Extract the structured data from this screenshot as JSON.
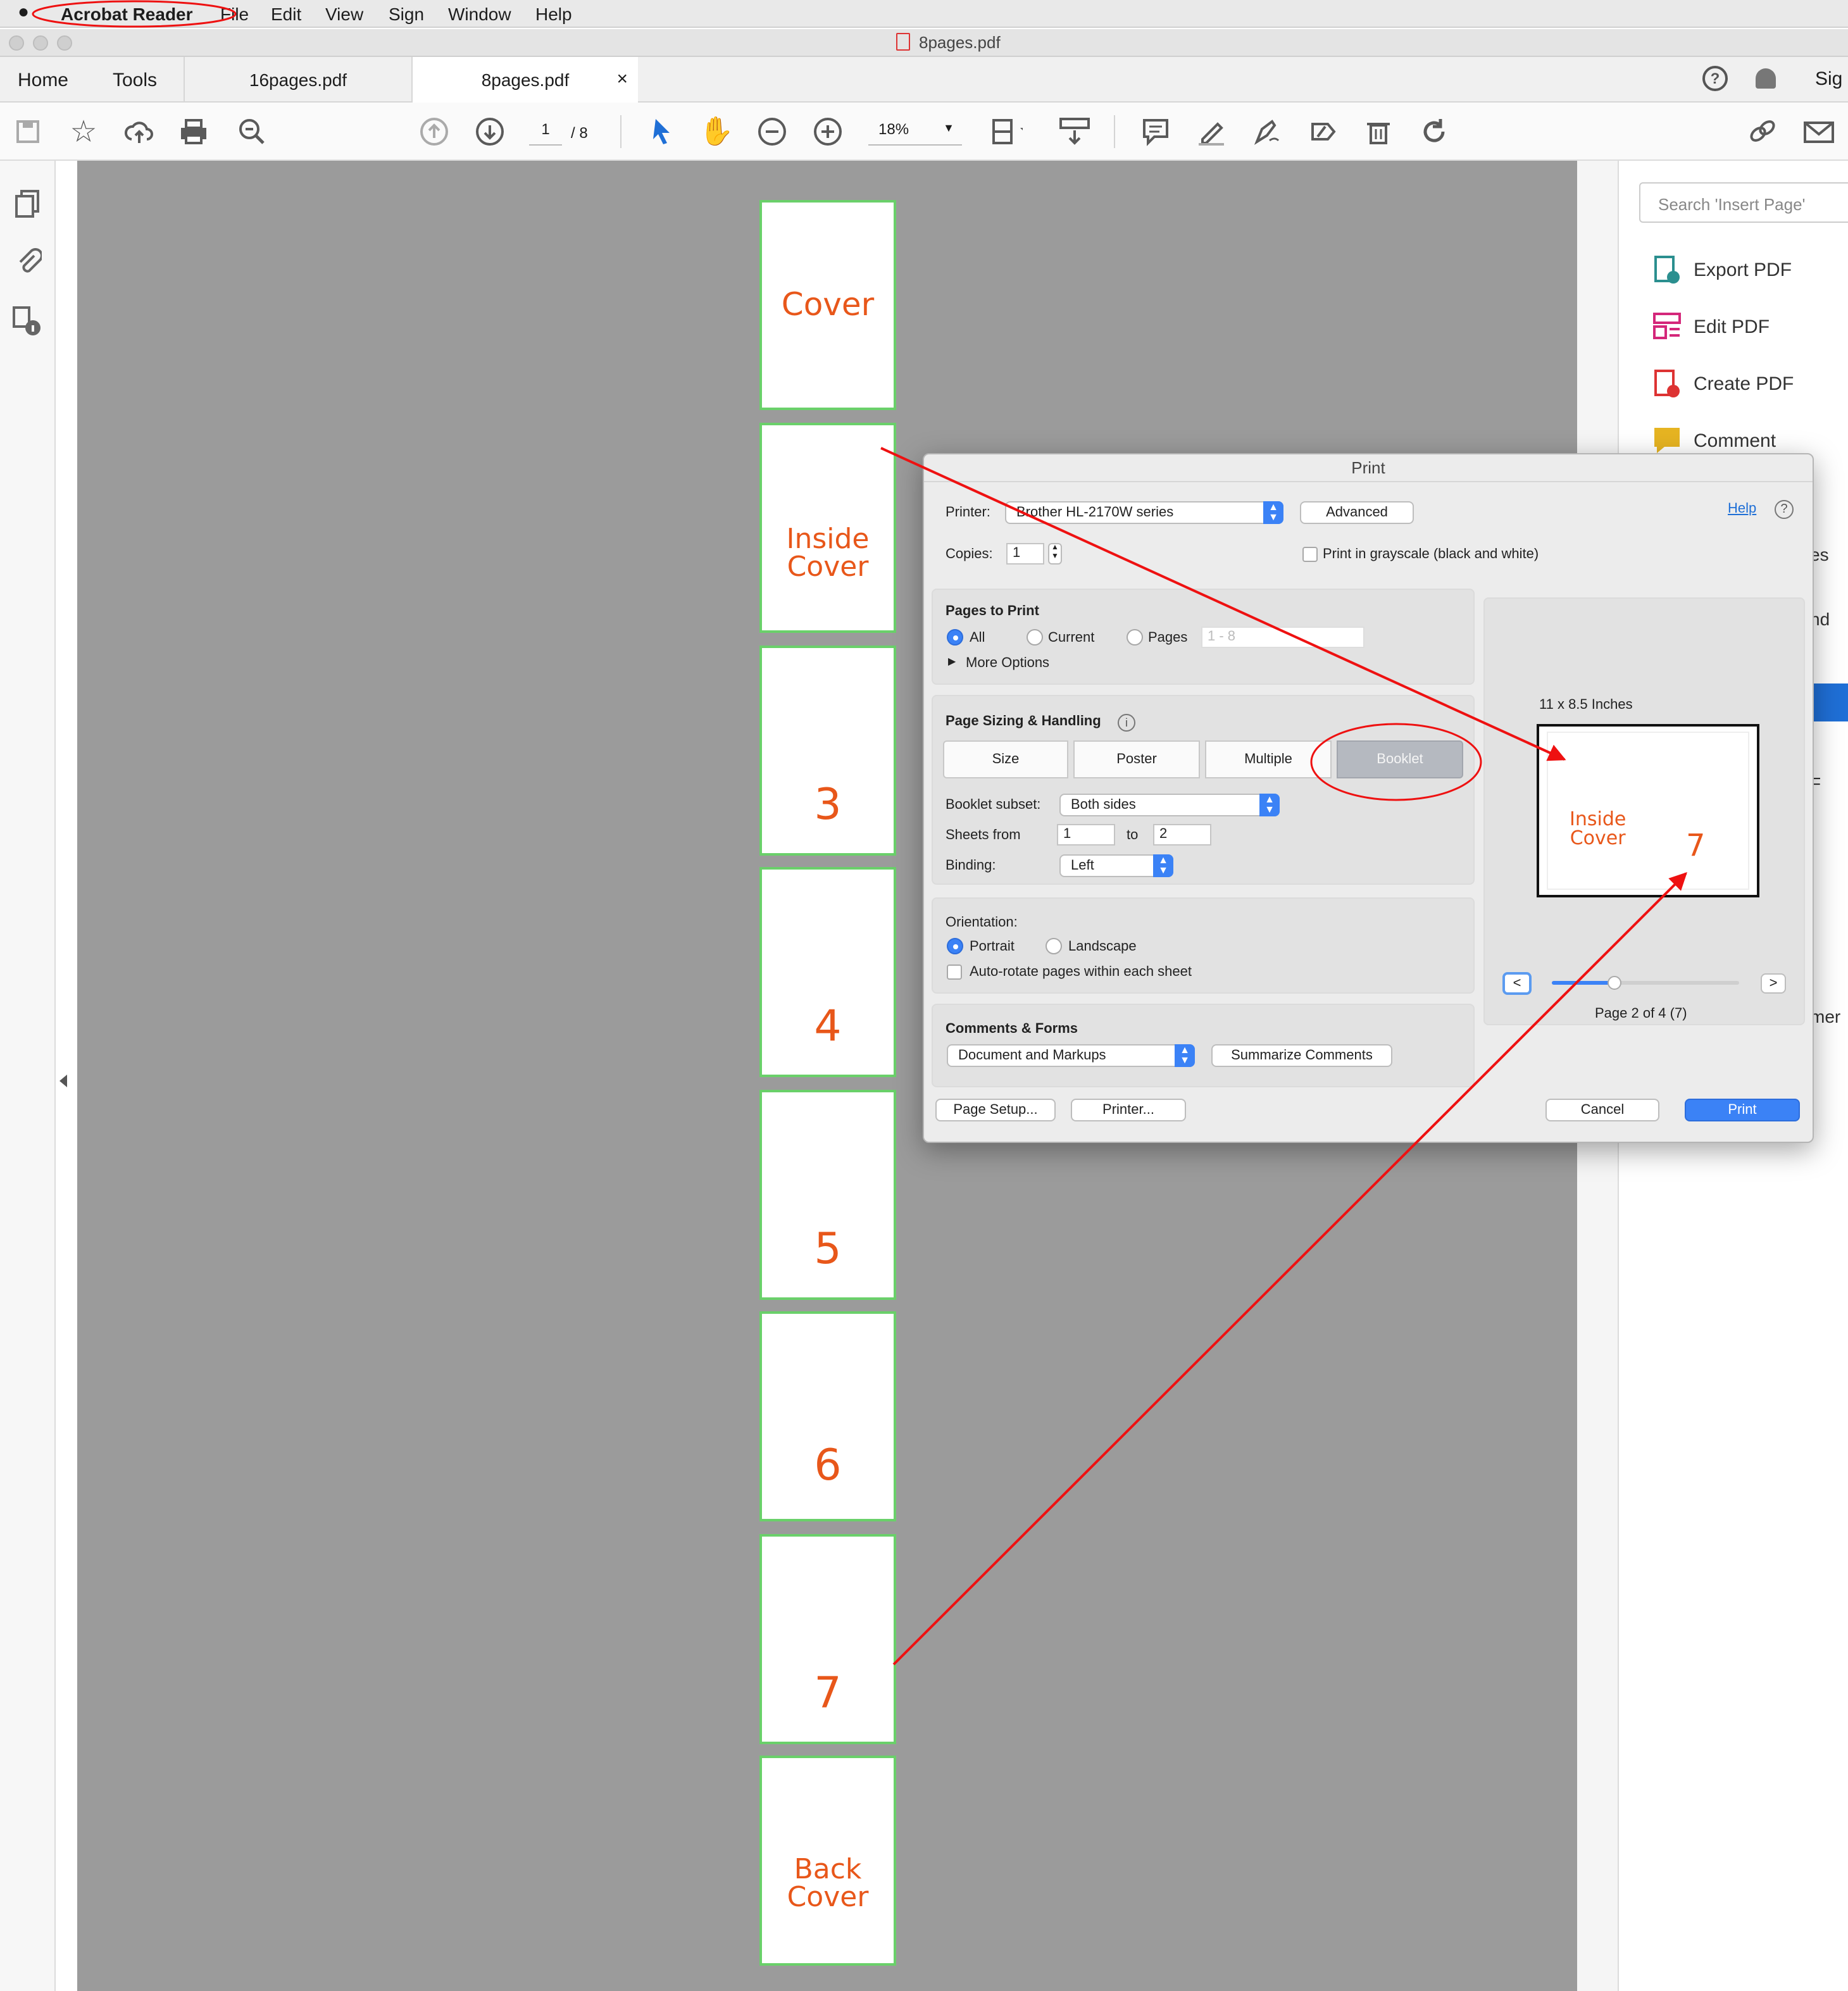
{
  "menubar": {
    "app": "Acrobat Reader",
    "items": [
      "File",
      "Edit",
      "View",
      "Sign",
      "Window",
      "Help"
    ]
  },
  "window": {
    "title": "8pages.pdf"
  },
  "tabs": {
    "home": "Home",
    "tools": "Tools",
    "doc1": "16pages.pdf",
    "doc2": "8pages.pdf",
    "close": "×",
    "sign_partial": "Sig"
  },
  "toolbar": {
    "page_current": "1",
    "page_total": "/ 8",
    "zoom": "18%"
  },
  "pages": [
    {
      "lines": [
        "Cover"
      ]
    },
    {
      "lines": [
        "Inside",
        "Cover"
      ]
    },
    {
      "lines": [
        "3"
      ]
    },
    {
      "lines": [
        "4"
      ]
    },
    {
      "lines": [
        "5"
      ]
    },
    {
      "lines": [
        "6"
      ]
    },
    {
      "lines": [
        "7"
      ]
    },
    {
      "lines": [
        "Back",
        "Cover"
      ]
    }
  ],
  "right_pane": {
    "search_placeholder": "Search 'Insert Page'",
    "tools": [
      "Export PDF",
      "Edit PDF",
      "Create PDF",
      "Comment"
    ],
    "partial": [
      "es",
      "nd",
      "F",
      "mer"
    ]
  },
  "dialog": {
    "title": "Print",
    "printer_label": "Printer:",
    "printer_value": "Brother HL-2170W series",
    "advanced": "Advanced",
    "help": "Help",
    "copies_label": "Copies:",
    "copies_value": "1",
    "grayscale": "Print in grayscale (black and white)",
    "pages_to_print": {
      "title": "Pages to Print",
      "all": "All",
      "current": "Current",
      "pages": "Pages",
      "range_placeholder": "1 - 8",
      "more": "More Options"
    },
    "sizing": {
      "title": "Page Sizing & Handling",
      "buttons": [
        "Size",
        "Poster",
        "Multiple",
        "Booklet"
      ],
      "subset_label": "Booklet subset:",
      "subset_value": "Both sides",
      "sheets_label": "Sheets from",
      "sheets_from": "1",
      "to_label": "to",
      "sheets_to": "2",
      "binding_label": "Binding:",
      "binding_value": "Left"
    },
    "orientation": {
      "title": "Orientation:",
      "portrait": "Portrait",
      "landscape": "Landscape",
      "autorotate": "Auto-rotate pages within each sheet"
    },
    "comments": {
      "title": "Comments & Forms",
      "value": "Document and Markups",
      "summarize": "Summarize Comments"
    },
    "preview": {
      "size": "11 x 8.5 Inches",
      "left_line1": "Inside",
      "left_line2": "Cover",
      "right": "7",
      "prev": "<",
      "next": ">",
      "page_info": "Page 2 of 4 (7)",
      "slider_fraction": 0.33
    },
    "footer": {
      "page_setup": "Page Setup...",
      "printer": "Printer...",
      "cancel": "Cancel",
      "print": "Print"
    }
  },
  "colors": {
    "accent": "#3b82f6",
    "page_text": "#e8571a",
    "annotation": "#ee1111",
    "canvas": "#9b9b9b"
  }
}
